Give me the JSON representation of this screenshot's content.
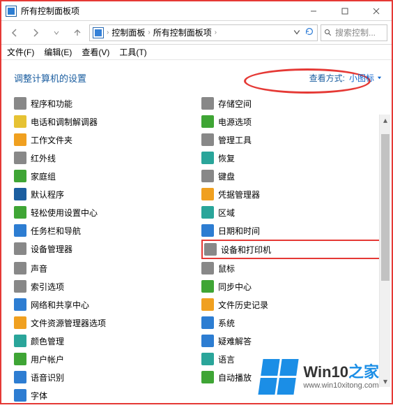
{
  "window": {
    "title": "所有控制面板项"
  },
  "navbar": {
    "path1": "控制面板",
    "path2": "所有控制面板项",
    "search_placeholder": "搜索控制..."
  },
  "menubar": {
    "file": "文件(F)",
    "edit": "编辑(E)",
    "view": "查看(V)",
    "tools": "工具(T)"
  },
  "content": {
    "heading": "调整计算机的设置",
    "viewby_label": "查看方式:",
    "viewby_value": "小图标"
  },
  "items_left": [
    {
      "label": "程序和功能",
      "icon": "bg-gray",
      "name": "programs-and-features"
    },
    {
      "label": "电话和调制解调器",
      "icon": "bg-yellow",
      "name": "phone-and-modem"
    },
    {
      "label": "工作文件夹",
      "icon": "bg-orange",
      "name": "work-folders"
    },
    {
      "label": "红外线",
      "icon": "bg-gray",
      "name": "infrared"
    },
    {
      "label": "家庭组",
      "icon": "bg-green",
      "name": "homegroup"
    },
    {
      "label": "默认程序",
      "icon": "bg-dblue",
      "name": "default-programs"
    },
    {
      "label": "轻松使用设置中心",
      "icon": "bg-green",
      "name": "ease-of-access"
    },
    {
      "label": "任务栏和导航",
      "icon": "bg-blue",
      "name": "taskbar-navigation"
    },
    {
      "label": "设备管理器",
      "icon": "bg-gray",
      "name": "device-manager"
    },
    {
      "label": "声音",
      "icon": "bg-gray",
      "name": "sound"
    },
    {
      "label": "索引选项",
      "icon": "bg-gray",
      "name": "indexing-options"
    },
    {
      "label": "网络和共享中心",
      "icon": "bg-blue",
      "name": "network-sharing"
    },
    {
      "label": "文件资源管理器选项",
      "icon": "bg-orange",
      "name": "file-explorer-options"
    },
    {
      "label": "颜色管理",
      "icon": "bg-teal",
      "name": "color-management"
    },
    {
      "label": "用户帐户",
      "icon": "bg-green",
      "name": "user-accounts"
    },
    {
      "label": "语音识别",
      "icon": "bg-blue",
      "name": "speech-recognition"
    },
    {
      "label": "字体",
      "icon": "bg-blue",
      "name": "fonts"
    }
  ],
  "items_right": [
    {
      "label": "存储空间",
      "icon": "bg-gray",
      "name": "storage-spaces"
    },
    {
      "label": "电源选项",
      "icon": "bg-green",
      "name": "power-options"
    },
    {
      "label": "管理工具",
      "icon": "bg-gray",
      "name": "admin-tools"
    },
    {
      "label": "恢复",
      "icon": "bg-teal",
      "name": "recovery"
    },
    {
      "label": "键盘",
      "icon": "bg-gray",
      "name": "keyboard"
    },
    {
      "label": "凭据管理器",
      "icon": "bg-orange",
      "name": "credential-manager"
    },
    {
      "label": "区域",
      "icon": "bg-teal",
      "name": "region"
    },
    {
      "label": "日期和时间",
      "icon": "bg-blue",
      "name": "date-and-time"
    },
    {
      "label": "设备和打印机",
      "icon": "bg-gray",
      "name": "devices-and-printers",
      "highlight": true
    },
    {
      "label": "鼠标",
      "icon": "bg-gray",
      "name": "mouse"
    },
    {
      "label": "同步中心",
      "icon": "bg-green",
      "name": "sync-center"
    },
    {
      "label": "文件历史记录",
      "icon": "bg-orange",
      "name": "file-history"
    },
    {
      "label": "系统",
      "icon": "bg-blue",
      "name": "system"
    },
    {
      "label": "疑难解答",
      "icon": "bg-blue",
      "name": "troubleshooting"
    },
    {
      "label": "语言",
      "icon": "bg-teal",
      "name": "language"
    },
    {
      "label": "自动播放",
      "icon": "bg-green",
      "name": "autoplay"
    }
  ],
  "watermark": {
    "brand1": "Win10",
    "brand2": "之家",
    "url": "www.win10xitong.com"
  }
}
